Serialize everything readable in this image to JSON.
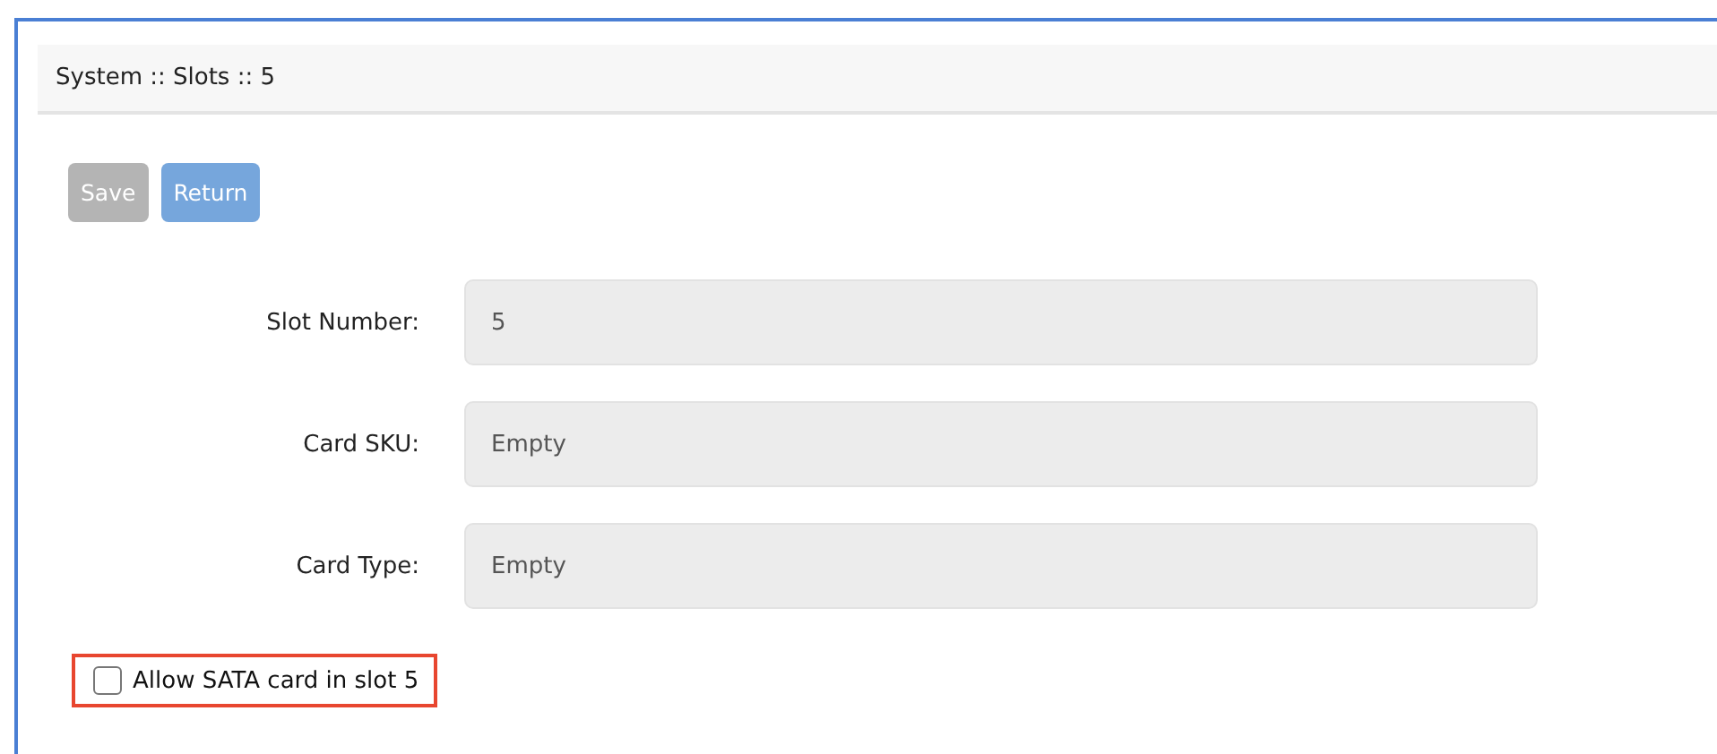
{
  "header": {
    "title": "System :: Slots :: 5"
  },
  "buttons": [
    {
      "label": "Save",
      "disabled": true
    },
    {
      "label": "Return",
      "disabled": false
    }
  ],
  "fields": [
    {
      "label": "Slot Number:",
      "value": "5"
    },
    {
      "label": "Card SKU:",
      "value": "Empty"
    },
    {
      "label": "Card Type:",
      "value": "Empty"
    }
  ],
  "checkbox": {
    "label": "Allow SATA card in slot 5",
    "checked": false,
    "highlighted": true
  }
}
